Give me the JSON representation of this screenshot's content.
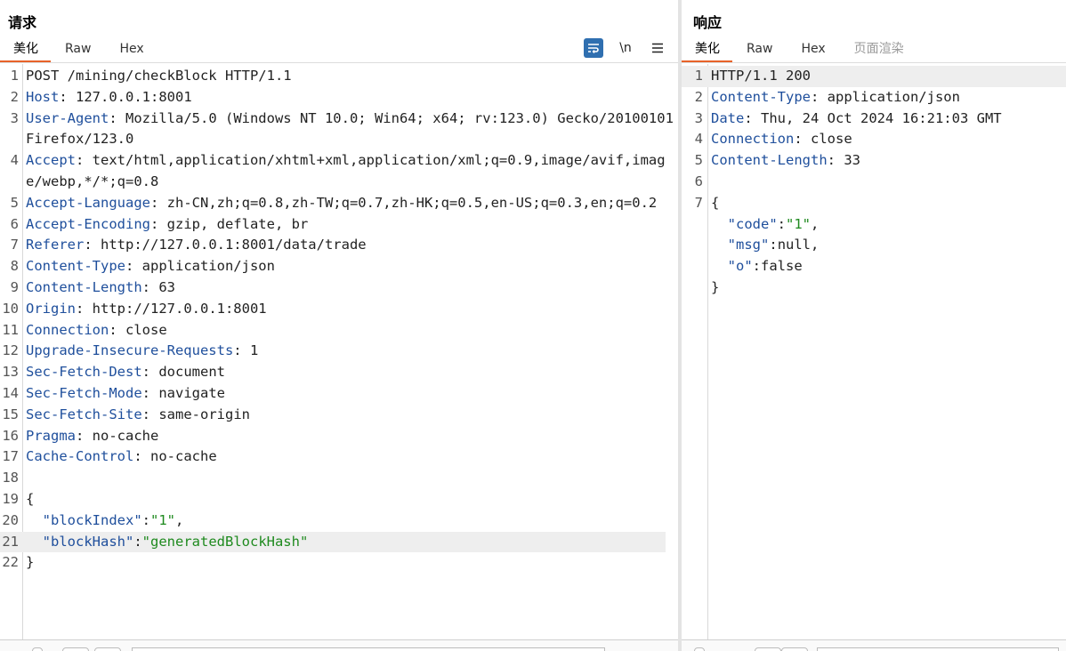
{
  "request": {
    "title": "请求",
    "tabs": [
      "美化",
      "Raw",
      "Hex"
    ],
    "active_tab": "美化",
    "tool_icons": [
      "word-wrap-icon",
      "newline-icon",
      "menu-icon"
    ],
    "tool_glyphs": [
      "\\n"
    ],
    "lines": [
      {
        "num": "1",
        "text": "POST /mining/checkBlock HTTP/1.1"
      },
      {
        "num": "2",
        "key": "Host",
        "value": "127.0.0.1:8001"
      },
      {
        "num": "3",
        "key": "User-Agent",
        "value": "Mozilla/5.0 (Windows NT 10.0; Win64; x64; rv:123.0) Gecko/20100101 Firefox/123.0"
      },
      {
        "num": "4",
        "key": "Accept",
        "value": "text/html,application/xhtml+xml,application/xml;q=0.9,image/avif,image/webp,*/*;q=0.8"
      },
      {
        "num": "5",
        "key": "Accept-Language",
        "value": "zh-CN,zh;q=0.8,zh-TW;q=0.7,zh-HK;q=0.5,en-US;q=0.3,en;q=0.2"
      },
      {
        "num": "6",
        "key": "Accept-Encoding",
        "value": "gzip, deflate, br"
      },
      {
        "num": "7",
        "key": "Referer",
        "value": "http://127.0.0.1:8001/data/trade"
      },
      {
        "num": "8",
        "key": "Content-Type",
        "value": "application/json"
      },
      {
        "num": "9",
        "key": "Content-Length",
        "value": "63"
      },
      {
        "num": "10",
        "key": "Origin",
        "value": "http://127.0.0.1:8001"
      },
      {
        "num": "11",
        "key": "Connection",
        "value": "close"
      },
      {
        "num": "12",
        "key": "Upgrade-Insecure-Requests",
        "value": "1"
      },
      {
        "num": "13",
        "key": "Sec-Fetch-Dest",
        "value": "document"
      },
      {
        "num": "14",
        "key": "Sec-Fetch-Mode",
        "value": "navigate"
      },
      {
        "num": "15",
        "key": "Sec-Fetch-Site",
        "value": "same-origin"
      },
      {
        "num": "16",
        "key": "Pragma",
        "value": "no-cache"
      },
      {
        "num": "17",
        "key": "Cache-Control",
        "value": "no-cache"
      },
      {
        "num": "18",
        "text": ""
      },
      {
        "num": "19",
        "text": "{"
      },
      {
        "num": "20",
        "jkey": "\"blockIndex\"",
        "jval": "\"1\"",
        "trail": ","
      },
      {
        "num": "21",
        "jkey": "\"blockHash\"",
        "jval": "\"generatedBlockHash\"",
        "trail": "",
        "highlight": true
      },
      {
        "num": "22",
        "text": "}"
      }
    ]
  },
  "response": {
    "title": "响应",
    "tabs": [
      "美化",
      "Raw",
      "Hex",
      "页面渲染"
    ],
    "active_tab": "美化",
    "disabled_tab": "页面渲染",
    "lines": [
      {
        "num": "1",
        "text": "HTTP/1.1 200",
        "highlight": true
      },
      {
        "num": "2",
        "key": "Content-Type",
        "value": "application/json"
      },
      {
        "num": "3",
        "key": "Date",
        "value": "Thu, 24 Oct 2024 16:21:03 GMT"
      },
      {
        "num": "4",
        "key": "Connection",
        "value": "close"
      },
      {
        "num": "5",
        "key": "Content-Length",
        "value": "33"
      },
      {
        "num": "6",
        "text": ""
      },
      {
        "num": "7",
        "text": "{"
      },
      {
        "num": "",
        "jkey": "\"code\"",
        "jval": "\"1\"",
        "trail": ","
      },
      {
        "num": "",
        "jkey": "\"msg\"",
        "plain": "null",
        "trail": ","
      },
      {
        "num": "",
        "jkey": "\"o\"",
        "plain": "false",
        "trail": ""
      },
      {
        "num": "",
        "text": "}"
      }
    ]
  },
  "colors": {
    "accent": "#e8632a",
    "header_key": "#1f4f9c",
    "string": "#1f8a1f",
    "tool_active": "#2f6fb0"
  }
}
